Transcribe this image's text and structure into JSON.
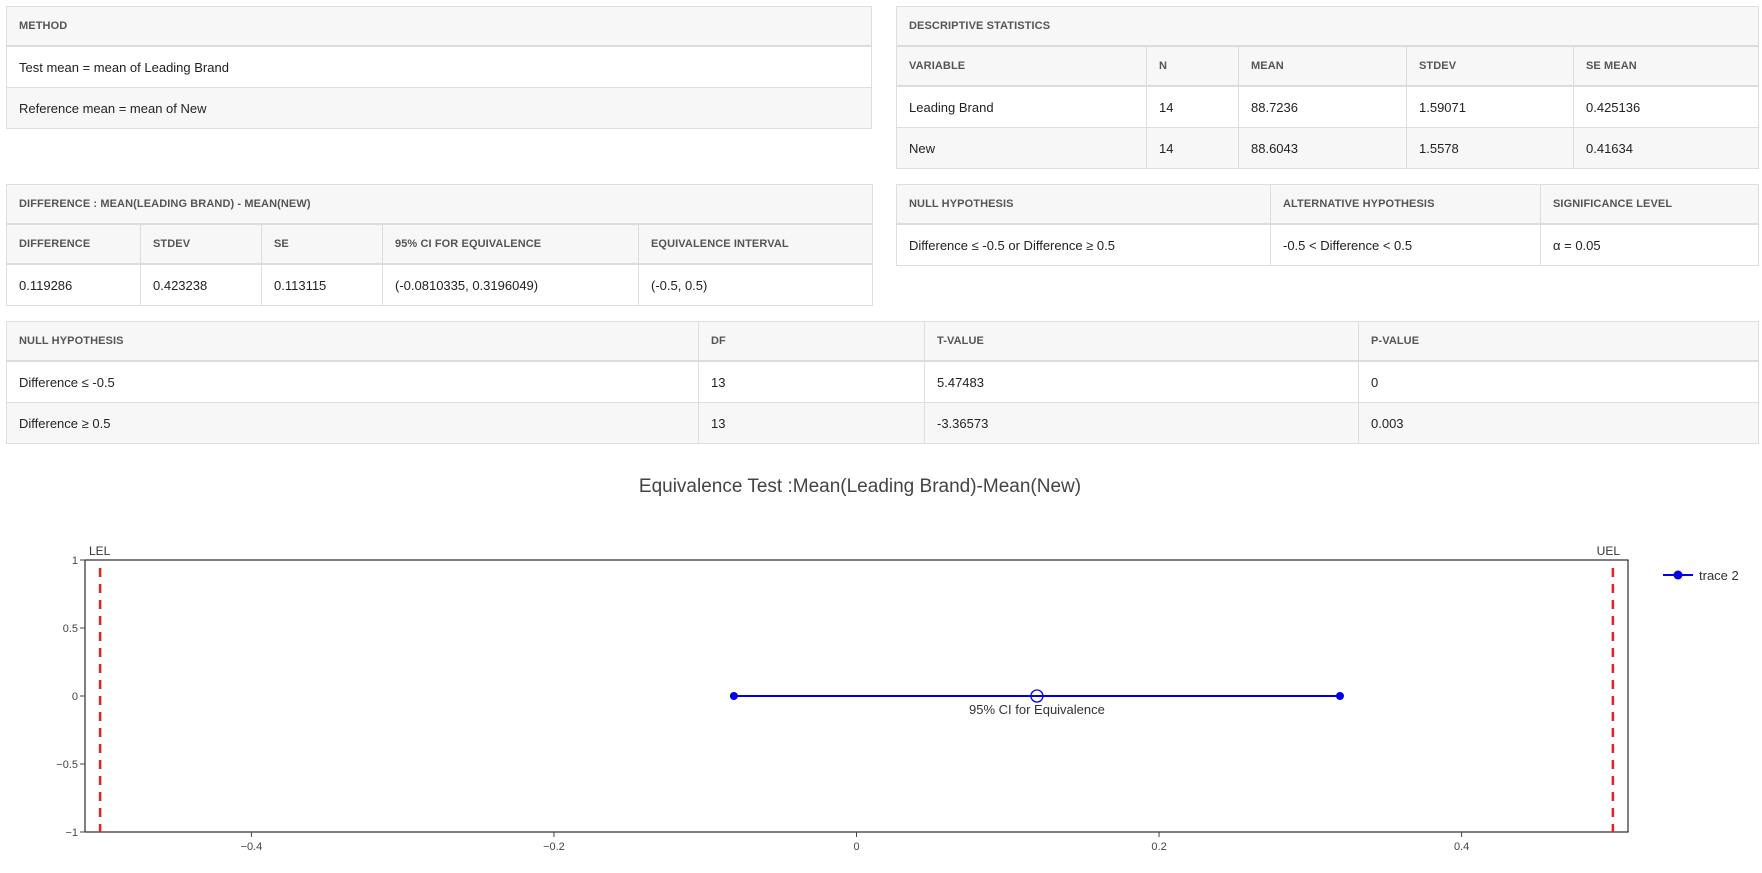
{
  "method": {
    "header": "METHOD",
    "rows": [
      "Test mean = mean of Leading Brand",
      "Reference mean = mean of New"
    ]
  },
  "descriptive": {
    "header": "DESCRIPTIVE STATISTICS",
    "columns": [
      "VARIABLE",
      "N",
      "MEAN",
      "STDEV",
      "SE MEAN"
    ],
    "rows": [
      [
        "Leading Brand",
        "14",
        "88.7236",
        "1.59071",
        "0.425136"
      ],
      [
        "New",
        "14",
        "88.6043",
        "1.5578",
        "0.41634"
      ]
    ]
  },
  "difference": {
    "header": "DIFFERENCE : MEAN(LEADING BRAND) - MEAN(NEW)",
    "columns": [
      "DIFFERENCE",
      "STDEV",
      "SE",
      "95% CI FOR EQUIVALENCE",
      "EQUIVALENCE INTERVAL"
    ],
    "row": [
      "0.119286",
      "0.423238",
      "0.113115",
      "(-0.0810335, 0.3196049)",
      "(-0.5, 0.5)"
    ]
  },
  "hypothesis": {
    "columns": [
      "NULL HYPOTHESIS",
      "ALTERNATIVE HYPOTHESIS",
      "SIGNIFICANCE LEVEL"
    ],
    "row": [
      "Difference ≤ -0.5 or Difference ≥ 0.5",
      "-0.5 < Difference < 0.5",
      "α = 0.05"
    ]
  },
  "tests": {
    "columns": [
      "NULL HYPOTHESIS",
      "DF",
      "T-VALUE",
      "P-VALUE"
    ],
    "rows": [
      [
        "Difference ≤ -0.5",
        "13",
        "5.47483",
        "0"
      ],
      [
        "Difference ≥ 0.5",
        "13",
        "-3.36573",
        "0.003"
      ]
    ]
  },
  "chart_data": {
    "type": "line",
    "title": "Equivalence Test :Mean(Leading Brand)-Mean(New)",
    "xlim": [
      -0.51,
      0.51
    ],
    "ylim": [
      -1,
      1
    ],
    "x_ticks": [
      -0.4,
      -0.2,
      0,
      0.2,
      0.4
    ],
    "x_tick_labels": [
      "−0.4",
      "−0.2",
      "0",
      "0.2",
      "0.4"
    ],
    "y_ticks": [
      1,
      0.5,
      0,
      -0.5,
      -1
    ],
    "y_tick_labels": [
      "1",
      "0.5",
      "0",
      "−0.5",
      "−1"
    ],
    "series": [
      {
        "name": "trace 2",
        "x": [
          -0.0810335,
          0.3196049
        ],
        "y": [
          0,
          0
        ],
        "color": "#0000ee"
      }
    ],
    "estimate": {
      "x": 0.119286,
      "y": 0,
      "label": "95% CI for Equivalence"
    },
    "limits": [
      {
        "label": "LEL",
        "x": -0.5,
        "color": "#e8231e"
      },
      {
        "label": "UEL",
        "x": 0.5,
        "color": "#e8231e"
      }
    ],
    "legend_position": "top-right",
    "grid": false
  }
}
